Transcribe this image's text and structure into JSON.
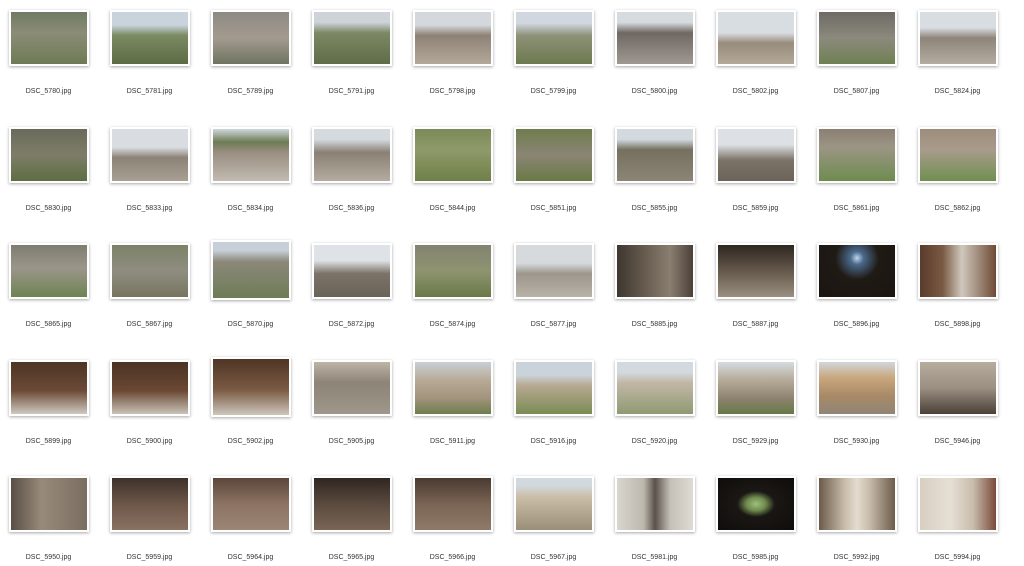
{
  "files": [
    {
      "name": "DSC_5780.jpg",
      "bg": "linear-gradient(180deg,#6f7a63 0%,#8b8c77 40%,#6d7b54 100%)"
    },
    {
      "name": "DSC_5781.jpg",
      "bg": "linear-gradient(180deg,#c9d3dc 0%,#c9d3dc 25%,#7a8a62 45%,#5d6b45 100%)"
    },
    {
      "name": "DSC_5789.jpg",
      "bg": "linear-gradient(180deg,#8d8a84 0%,#a39a8e 50%,#6e7460 100%)"
    },
    {
      "name": "DSC_5791.jpg",
      "bg": "linear-gradient(180deg,#cdd3d8 0%,#cdd3d8 20%,#7d8866 40%,#5f6c47 100%)"
    },
    {
      "name": "DSC_5798.jpg",
      "bg": "linear-gradient(180deg,#d4d8dc 0%,#d4d8dc 25%,#8d8275 45%,#b3a89a 100%)"
    },
    {
      "name": "DSC_5799.jpg",
      "bg": "linear-gradient(180deg,#d0d7df 0%,#d0d7df 22%,#8e9178 45%,#6c7a4f 100%)"
    },
    {
      "name": "DSC_5800.jpg",
      "bg": "linear-gradient(180deg,#d6dbe0 0%,#d6dbe0 20%,#6f6862 40%,#9f9992 100%)"
    },
    {
      "name": "DSC_5802.jpg",
      "bg": "linear-gradient(180deg,#d8dde2 0%,#d8dde2 40%,#988c7c 60%,#b2a999 100%)"
    },
    {
      "name": "DSC_5807.jpg",
      "bg": "linear-gradient(180deg,#6c6a63 0%,#8c8a7d 50%,#6f8052 100%)"
    },
    {
      "name": "DSC_5824.jpg",
      "bg": "linear-gradient(180deg,#d8dde2 0%,#d8dde2 30%,#8e857a 50%,#b3aca0 100%)"
    },
    {
      "name": "DSC_5830.jpg",
      "bg": "linear-gradient(180deg,#6a6a5c 0%,#7d7d67 50%,#5e6d43 100%)"
    },
    {
      "name": "DSC_5833.jpg",
      "bg": "linear-gradient(180deg,#d9dde1 0%,#d9dde1 35%,#8c8376 55%,#a8a092 100%)"
    },
    {
      "name": "DSC_5834.jpg",
      "bg": "linear-gradient(180deg,#cfd6dc 0%,#6d7b55 25%,#998e80 45%,#c2bbb0 100%)"
    },
    {
      "name": "DSC_5836.jpg",
      "bg": "linear-gradient(180deg,#d5dadf 0%,#d5dadf 20%,#8a8074 45%,#b4ac9f 100%)"
    },
    {
      "name": "DSC_5844.jpg",
      "bg": "linear-gradient(180deg,#7a8a58 0%,#8f9a6a 40%,#6f8048 100%)"
    },
    {
      "name": "DSC_5851.jpg",
      "bg": "linear-gradient(180deg,#6f7d4d 0%,#8a8574 50%,#6a7a45 100%)"
    },
    {
      "name": "DSC_5855.jpg",
      "bg": "linear-gradient(180deg,#d2d9df 0%,#d2d9df 20%,#75705f 40%,#8c8577 100%)"
    },
    {
      "name": "DSC_5859.jpg",
      "bg": "linear-gradient(180deg,#dde1e5 0%,#dde1e5 30%,#7c7367 60%,#6b6358 100%)"
    },
    {
      "name": "DSC_5861.jpg",
      "bg": "linear-gradient(180deg,#8a7f73 0%,#9c9585 35%,#6e8c4e 100%)"
    },
    {
      "name": "DSC_5862.jpg",
      "bg": "linear-gradient(180deg,#9c8c7c 0%,#a99b8b 40%,#6f8f4f 100%)"
    },
    {
      "name": "DSC_5865.jpg",
      "bg": "linear-gradient(180deg,#7f7c70 0%,#9a968a 45%,#6f8352 100%)"
    },
    {
      "name": "DSC_5867.jpg",
      "bg": "linear-gradient(180deg,#7c8268 0%,#8f8d80 50%,#77745f 100%)",
      "tall": false
    },
    {
      "name": "DSC_5870.jpg",
      "bg": "linear-gradient(180deg,#c7d0d8 0%,#c7d0d8 15%,#8c887a 35%,#6e7c55 100%)",
      "tall": true
    },
    {
      "name": "DSC_5872.jpg",
      "bg": "linear-gradient(180deg,#dfe3e7 0%,#dfe3e7 30%,#7b7367 55%,#6a6357 100%)"
    },
    {
      "name": "DSC_5874.jpg",
      "bg": "linear-gradient(180deg,#838372 0%,#8e9470 50%,#6a7848 100%)"
    },
    {
      "name": "DSC_5877.jpg",
      "bg": "linear-gradient(180deg,#d6dadd 0%,#d6dadd 35%,#9c968c 55%,#b8b2a7 100%)"
    },
    {
      "name": "DSC_5885.jpg",
      "bg": "linear-gradient(90deg,#3d3630 0%,#6b5f52 40%,#8a7e70 70%,#4a4038 100%)"
    },
    {
      "name": "DSC_5887.jpg",
      "bg": "linear-gradient(180deg,#2d2721 0%,#5a4e42 40%,#9a8f80 100%)"
    },
    {
      "name": "DSC_5896.jpg",
      "bg": "radial-gradient(circle at 50% 25%,#bfd6ee 0%,#4a6a8c 12%,#201a15 40%,#1a1511 100%)"
    },
    {
      "name": "DSC_5898.jpg",
      "bg": "linear-gradient(90deg,#5a3b2a 0%,#7a5a44 30%,#cfc8bd 55%,#6e4a35 100%)"
    },
    {
      "name": "DSC_5899.jpg",
      "bg": "linear-gradient(180deg,#4d3426 0%,#6b4a36 55%,#cfc9c0 100%)"
    },
    {
      "name": "DSC_5900.jpg",
      "bg": "linear-gradient(180deg,#4a3124 0%,#6a4833 55%,#c9c2b8 100%)"
    },
    {
      "name": "DSC_5902.jpg",
      "bg": "linear-gradient(180deg,#4f3526 0%,#7a5a43 55%,#cdc6bb 100%)",
      "tall": true
    },
    {
      "name": "DSC_5905.jpg",
      "bg": "linear-gradient(180deg,#bdb4a6 0%,#8d8477 40%,#9f978b 100%)"
    },
    {
      "name": "DSC_5911.jpg",
      "bg": "linear-gradient(180deg,#c8cfd6 0%,#b8ab95 35%,#a1937c 70%,#6d7e4c 100%)"
    },
    {
      "name": "DSC_5916.jpg",
      "bg": "linear-gradient(180deg,#cbd3da 0%,#cbd3da 25%,#b7a992 45%,#7a8b55 100%)"
    },
    {
      "name": "DSC_5920.jpg",
      "bg": "linear-gradient(180deg,#d3d9de 0%,#d3d9de 20%,#c2b7a6 40%,#8f9a72 100%)"
    },
    {
      "name": "DSC_5929.jpg",
      "bg": "linear-gradient(180deg,#d5dbe0 0%,#b6aa98 35%,#8e8270 70%,#657a45 100%)"
    },
    {
      "name": "DSC_5930.jpg",
      "bg": "linear-gradient(180deg,#d0d6db 0%,#c9a77e 30%,#a98a66 65%,#8f8577 100%)"
    },
    {
      "name": "DSC_5946.jpg",
      "bg": "linear-gradient(180deg,#b7ad9e 0%,#9a8f80 50%,#4a4037 100%)"
    },
    {
      "name": "DSC_5950.jpg",
      "bg": "linear-gradient(90deg,#5a4f45 0%,#978a7a 40%,#7a6e62 100%)"
    },
    {
      "name": "DSC_5959.jpg",
      "bg": "linear-gradient(180deg,#3d312a 0%,#6d5648 50%,#8a7262 100%)"
    },
    {
      "name": "DSC_5964.jpg",
      "bg": "linear-gradient(180deg,#5b473b 0%,#8c7363 50%,#9c8575 100%)"
    },
    {
      "name": "DSC_5965.jpg",
      "bg": "linear-gradient(180deg,#2f2620 0%,#5a4a3e 50%,#7a6556 100%)"
    },
    {
      "name": "DSC_5966.jpg",
      "bg": "linear-gradient(180deg,#4a3a30 0%,#7a6454 50%,#8f7a6a 100%)"
    },
    {
      "name": "DSC_5967.jpg",
      "bg": "linear-gradient(180deg,#d1d8de 0%,#d1d8de 15%,#cbbfa9 35%,#9b8e78 100%)"
    },
    {
      "name": "DSC_5981.jpg",
      "bg": "linear-gradient(90deg,#d9d6cf 0%,#bdb8ae 35%,#5a524a 50%,#c5c0b7 70%,#dedbd4 100%)"
    },
    {
      "name": "DSC_5985.jpg",
      "bg": "radial-gradient(ellipse at 50% 50%,#9fc07a 0%,#6f8a4e 18%,#1a1714 35%,#0f0d0b 100%)"
    },
    {
      "name": "DSC_5992.jpg",
      "bg": "linear-gradient(90deg,#6b5b4a 0%,#cbbfae 35%,#e3dccf 50%,#cbbfae 65%,#6b5b4a 100%)"
    },
    {
      "name": "DSC_5994.jpg",
      "bg": "linear-gradient(90deg,#d8cfc2 0%,#e6dfd4 40%,#c8bcac 70%,#7a4a3a 100%)"
    }
  ]
}
